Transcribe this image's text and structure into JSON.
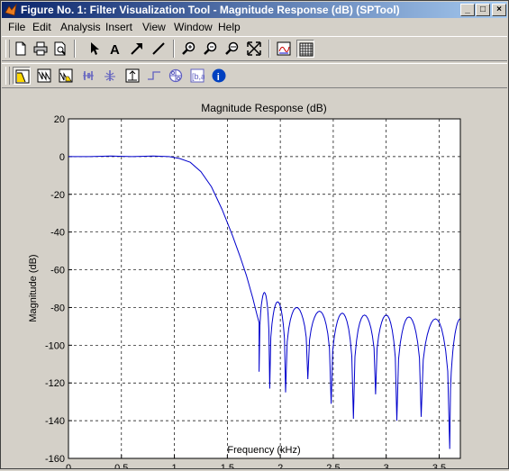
{
  "window": {
    "title": "Figure No. 1: Filter Visualization Tool - Magnitude Response (dB) (SPTool)",
    "minimize_glyph": "_",
    "maximize_glyph": "□",
    "close_glyph": "×"
  },
  "menu": {
    "items": [
      "File",
      "Edit",
      "Analysis",
      "Insert",
      "View",
      "Window",
      "Help"
    ]
  },
  "toolbar1": {
    "icons": [
      "new-icon",
      "print-icon",
      "print-preview-icon",
      "select-arrow-icon",
      "insert-text-icon",
      "insert-arrow-icon",
      "insert-line-icon",
      "zoom-in-icon",
      "zoom-out-icon",
      "zoom-x-icon",
      "full-view-icon",
      "legend-icon",
      "grid-icon"
    ]
  },
  "toolbar2": {
    "icons": [
      "magnitude-response-icon",
      "phase-response-icon",
      "magnitude-phase-icon",
      "group-delay-icon",
      "phase-delay-icon",
      "impulse-response-icon",
      "step-response-icon",
      "pole-zero-icon",
      "filter-coefficients-icon",
      "filter-info-icon"
    ],
    "info_glyph": "i"
  },
  "colors": {
    "title_bar_start": "#0a246a",
    "title_bar_end": "#a6caf0",
    "line": "#0000cc",
    "grid": "#000000"
  },
  "chart_data": {
    "type": "line",
    "title": "Magnitude Response (dB)",
    "xlabel": "Frequency (kHz)",
    "ylabel": "Magnitude (dB)",
    "xlim": [
      0,
      3.7
    ],
    "ylim": [
      -160,
      20
    ],
    "xticks": [
      "0",
      "0.5",
      "1",
      "1.5",
      "2",
      "2.5",
      "3",
      "3.5"
    ],
    "yticks": [
      "20",
      "0",
      "-20",
      "-40",
      "-60",
      "-80",
      "-100",
      "-120",
      "-140",
      "-160"
    ],
    "grid": true,
    "series": [
      {
        "x": [
          0,
          0.2,
          0.4,
          0.6,
          0.8,
          0.95,
          1.05,
          1.15,
          1.25,
          1.35,
          1.45,
          1.55,
          1.62,
          1.68,
          1.74,
          1.78,
          1.8
        ],
        "y": [
          0,
          0,
          0.3,
          0,
          0.3,
          0,
          -1,
          -3,
          -8,
          -16,
          -28,
          -42,
          -53,
          -63,
          -75,
          -84,
          -88
        ],
        "nulls": [
          {
            "f": 1.8,
            "depth": -114
          },
          {
            "f": 1.9,
            "depth": -123
          },
          {
            "f": 2.05,
            "depth": -125
          },
          {
            "f": 2.26,
            "depth": -118
          },
          {
            "f": 2.48,
            "depth": -131
          },
          {
            "f": 2.69,
            "depth": -139
          },
          {
            "f": 2.9,
            "depth": -126
          },
          {
            "f": 3.1,
            "depth": -140
          },
          {
            "f": 3.33,
            "depth": -138
          },
          {
            "f": 3.6,
            "depth": -155
          }
        ],
        "lobe_peaks": [
          {
            "f": 1.85,
            "peak": -72
          },
          {
            "f": 1.96,
            "peak": -77
          },
          {
            "f": 2.15,
            "peak": -80
          },
          {
            "f": 2.37,
            "peak": -82
          },
          {
            "f": 2.58,
            "peak": -83
          },
          {
            "f": 2.8,
            "peak": -84
          },
          {
            "f": 3.0,
            "peak": -84
          },
          {
            "f": 3.22,
            "peak": -85
          },
          {
            "f": 3.46,
            "peak": -86
          },
          {
            "f": 3.7,
            "peak": -86
          }
        ]
      }
    ]
  }
}
